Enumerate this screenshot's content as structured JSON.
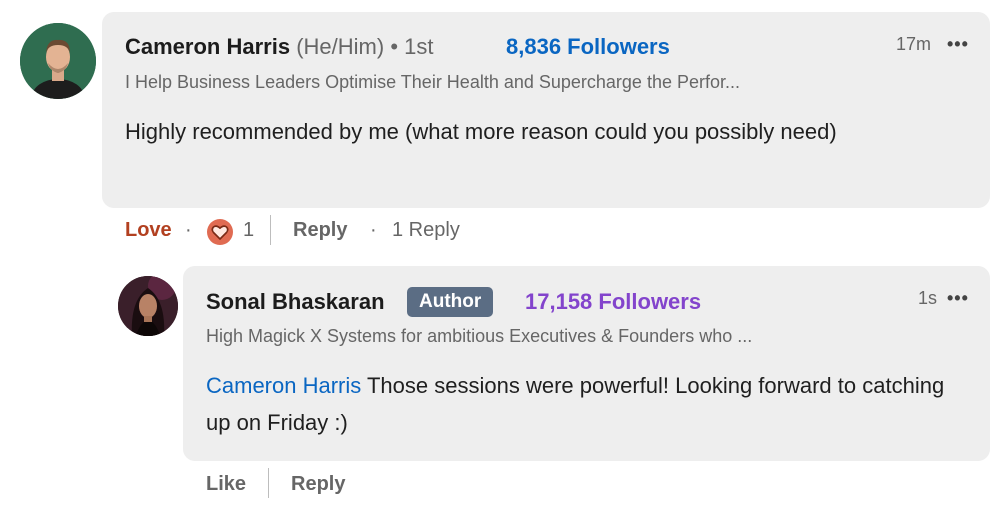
{
  "comment": {
    "author_name": "Cameron Harris",
    "pronouns": "(He/Him)",
    "degree": "• 1st",
    "followers": "8,836 Followers",
    "headline": "I Help Business Leaders Optimise Their Health and Supercharge the Perfor...",
    "time": "17m",
    "more": "•••",
    "text": "Highly recommended by me (what more reason could you possibly need)",
    "actions": {
      "reaction_label": "Love",
      "dot": "·",
      "reaction_count": "1",
      "reply_label": "Reply",
      "reply_count_dot": "·",
      "reply_count": "1 Reply"
    },
    "colors": {
      "followers": "#0a66c2",
      "love": "#b24020"
    }
  },
  "reply": {
    "author_name": "Sonal Bhaskaran",
    "badge": "Author",
    "followers": "17,158 Followers",
    "headline": "High Magick X Systems for ambitious Executives & Founders who ...",
    "time": "1s",
    "more": "•••",
    "mention": "Cameron Harris",
    "text": "Those sessions were powerful! Looking forward to catching up on Friday :)",
    "actions": {
      "like_label": "Like",
      "reply_label": "Reply"
    },
    "colors": {
      "followers": "#8344cc",
      "badge": "#5b6d84"
    }
  },
  "icons": {
    "love_reaction": "heart-reaction-icon"
  }
}
